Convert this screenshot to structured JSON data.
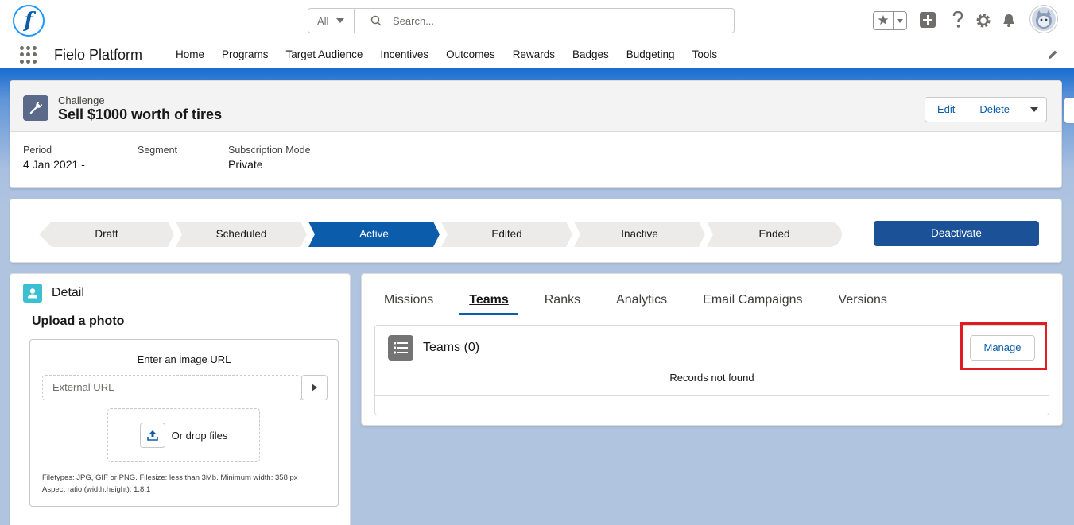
{
  "header": {
    "search_scope": "All",
    "search_placeholder": "Search..."
  },
  "nav": {
    "app_name": "Fielo Platform",
    "items": [
      "Home",
      "Programs",
      "Target Audience",
      "Incentives",
      "Outcomes",
      "Rewards",
      "Badges",
      "Budgeting",
      "Tools"
    ]
  },
  "record": {
    "entity_type": "Challenge",
    "title": "Sell $1000 worth of tires",
    "actions": {
      "edit": "Edit",
      "delete": "Delete"
    },
    "fields": [
      {
        "label": "Period",
        "value": "4 Jan 2021 -"
      },
      {
        "label": "Segment",
        "value": ""
      },
      {
        "label": "Subscription Mode",
        "value": "Private"
      }
    ]
  },
  "path": {
    "stages": [
      "Draft",
      "Scheduled",
      "Active",
      "Edited",
      "Inactive",
      "Ended"
    ],
    "active_stage": "Active",
    "action_label": "Deactivate"
  },
  "detail": {
    "title": "Detail",
    "upload_title": "Upload a photo",
    "enter_url_label": "Enter an image URL",
    "url_placeholder": "External URL",
    "drop_label": "Or drop files",
    "hint_line1": "Filetypes: JPG, GIF or PNG. Filesize: less than 3Mb. Minimum width: 358 px",
    "hint_line2": "Aspect ratio (width:height): 1.8:1"
  },
  "related": {
    "tabs": [
      "Missions",
      "Teams",
      "Ranks",
      "Analytics",
      "Email Campaigns",
      "Versions"
    ],
    "active_tab": "Teams",
    "list_title": "Teams (0)",
    "manage_label": "Manage",
    "empty_text": "Records not found"
  },
  "colors": {
    "brand": "#0b5cab",
    "deactivate": "#1b5297",
    "highlight_box": "#e01b24"
  }
}
